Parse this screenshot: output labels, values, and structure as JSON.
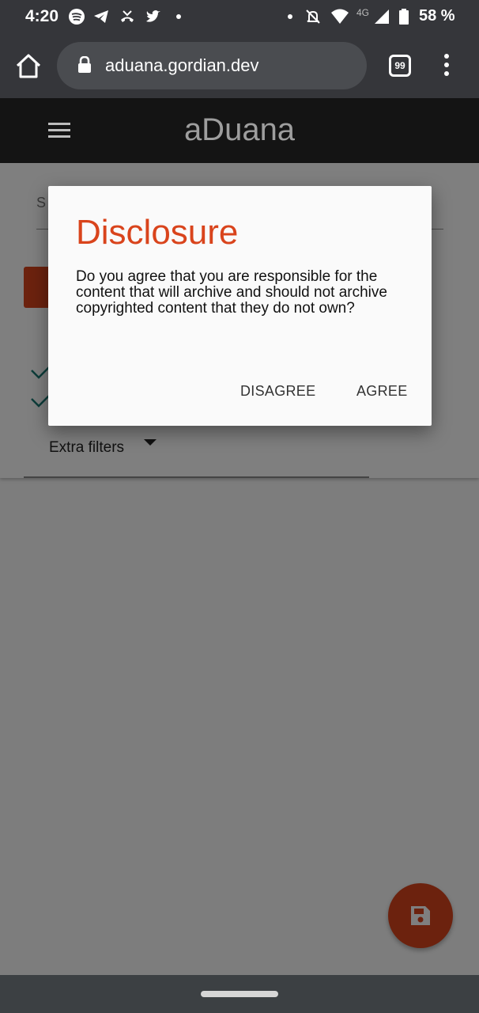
{
  "status_bar": {
    "time": "4:20",
    "network": "4G",
    "battery": "58 %"
  },
  "browser": {
    "url": "aduana.gordian.dev",
    "tab_count": "99"
  },
  "app": {
    "title": "aDuana",
    "extra_filters_label": "Extra filters"
  },
  "dialog": {
    "title": "Disclosure",
    "body": "Do you agree that you are responsible for the content that will archive and should not archive copyrighted content that they do not own?",
    "disagree_label": "DISAGREE",
    "agree_label": "AGREE"
  },
  "colors": {
    "accent": "#d9441c",
    "check": "#1a7a75"
  }
}
